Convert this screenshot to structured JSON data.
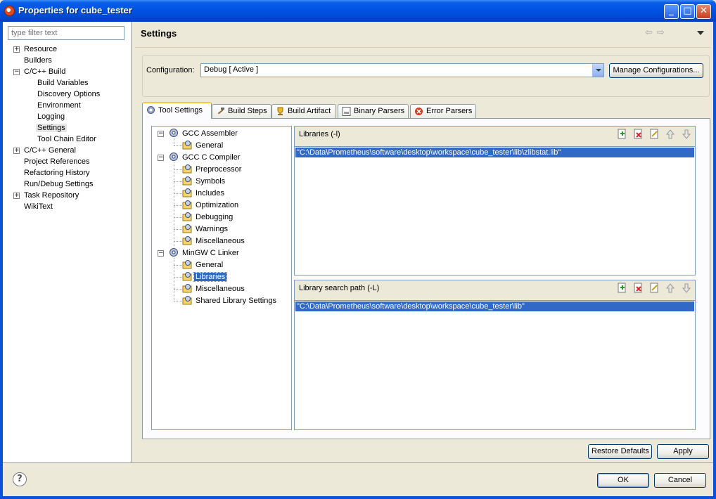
{
  "window": {
    "title": "Properties for cube_tester"
  },
  "filter": {
    "placeholder": "type filter text"
  },
  "nav": {
    "items": [
      {
        "label": "Resource",
        "expander": "+"
      },
      {
        "label": "Builders"
      },
      {
        "label": "C/C++ Build",
        "expander": "−"
      },
      {
        "label": "Build Variables"
      },
      {
        "label": "Discovery Options"
      },
      {
        "label": "Environment"
      },
      {
        "label": "Logging"
      },
      {
        "label": "Settings"
      },
      {
        "label": "Tool Chain Editor"
      },
      {
        "label": "C/C++ General",
        "expander": "+"
      },
      {
        "label": "Project References"
      },
      {
        "label": "Refactoring History"
      },
      {
        "label": "Run/Debug Settings"
      },
      {
        "label": "Task Repository",
        "expander": "+"
      },
      {
        "label": "WikiText"
      }
    ]
  },
  "page": {
    "title": "Settings"
  },
  "configuration": {
    "label": "Configuration:",
    "value": "Debug  [ Active ]",
    "manage_label": "Manage Configurations..."
  },
  "tabs": [
    {
      "label": "Tool Settings",
      "active": true
    },
    {
      "label": "Build Steps"
    },
    {
      "label": "Build Artifact"
    },
    {
      "label": "Binary Parsers"
    },
    {
      "label": "Error Parsers"
    }
  ],
  "tool_tree": {
    "items": [
      {
        "label": "GCC Assembler"
      },
      {
        "label": "General"
      },
      {
        "label": "GCC C Compiler"
      },
      {
        "label": "Preprocessor"
      },
      {
        "label": "Symbols"
      },
      {
        "label": "Includes"
      },
      {
        "label": "Optimization"
      },
      {
        "label": "Debugging"
      },
      {
        "label": "Warnings"
      },
      {
        "label": "Miscellaneous"
      },
      {
        "label": "MinGW C Linker"
      },
      {
        "label": "General"
      },
      {
        "label": "Libraries"
      },
      {
        "label": "Miscellaneous"
      },
      {
        "label": "Shared Library Settings"
      }
    ]
  },
  "libraries": {
    "title": "Libraries (-l)",
    "entries": [
      "\"C:\\Data\\Prometheus\\software\\desktop\\workspace\\cube_tester\\lib\\zlibstat.lib\""
    ]
  },
  "library_paths": {
    "title": "Library search path (-L)",
    "entries": [
      "\"C:\\Data\\Prometheus\\software\\desktop\\workspace\\cube_tester\\lib\""
    ]
  },
  "buttons": {
    "restore_defaults": "Restore Defaults",
    "apply": "Apply",
    "ok": "OK",
    "cancel": "Cancel"
  },
  "colors": {
    "selection": "#316ac5",
    "titlebar": "#0054e3",
    "face": "#ece9d8"
  }
}
